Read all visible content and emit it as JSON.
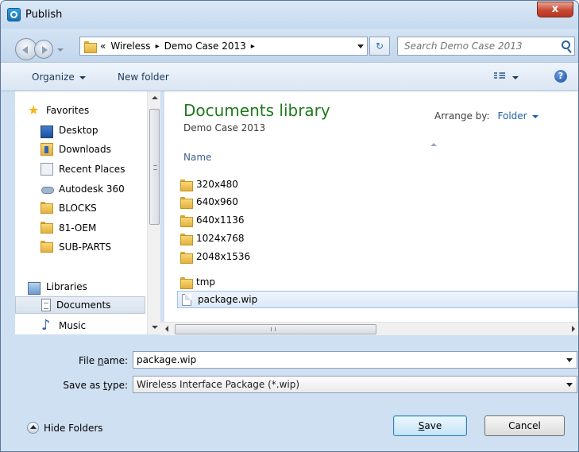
{
  "window": {
    "title": "Publish",
    "close_glyph": "x",
    "app_icon": "app-logo-icon"
  },
  "address": {
    "overflow": "«",
    "crumbs": [
      "Wireless",
      "Demo Case 2013"
    ],
    "separator": "▸",
    "refresh_glyph": "↻"
  },
  "search": {
    "placeholder": "Search Demo Case 2013"
  },
  "toolbar": {
    "organize_label": "Organize",
    "new_folder_label": "New folder",
    "help_glyph": "?"
  },
  "navpane": {
    "favorites_label": "Favorites",
    "favorites": [
      "Desktop",
      "Downloads",
      "Recent Places",
      "Autodesk 360",
      "BLOCKS",
      "81-OEM",
      "SUB-PARTS"
    ],
    "libraries_label": "Libraries",
    "libraries": [
      "Documents",
      "Music"
    ]
  },
  "content": {
    "library_title": "Documents library",
    "library_subtitle": "Demo Case 2013",
    "arrange_by_label": "Arrange by:",
    "arrange_by_value": "Folder",
    "column_name": "Name",
    "files": [
      {
        "name": "320x480",
        "type": "folder"
      },
      {
        "name": "640x960",
        "type": "folder"
      },
      {
        "name": "640x1136",
        "type": "folder"
      },
      {
        "name": "1024x768",
        "type": "folder"
      },
      {
        "name": "2048x1536",
        "type": "folder"
      },
      {
        "name": "tmp",
        "type": "folder"
      },
      {
        "name": "package.wip",
        "type": "file",
        "selected": true
      }
    ]
  },
  "form": {
    "file_name_label_pre": "File ",
    "file_name_label_ul": "n",
    "file_name_label_post": "ame:",
    "file_name_value": "package.wip",
    "save_type_label_pre": "Save as ",
    "save_type_label_ul": "t",
    "save_type_label_post": "ype:",
    "save_type_value": "Wireless Interface Package (*.wip)"
  },
  "footer": {
    "hide_folders_label": "Hide Folders",
    "save_ul": "S",
    "save_rest": "ave",
    "cancel_label": "Cancel"
  },
  "colors": {
    "library_title": "#1e7a1e",
    "link": "#1e5faa",
    "close_button": "#c74a34"
  }
}
